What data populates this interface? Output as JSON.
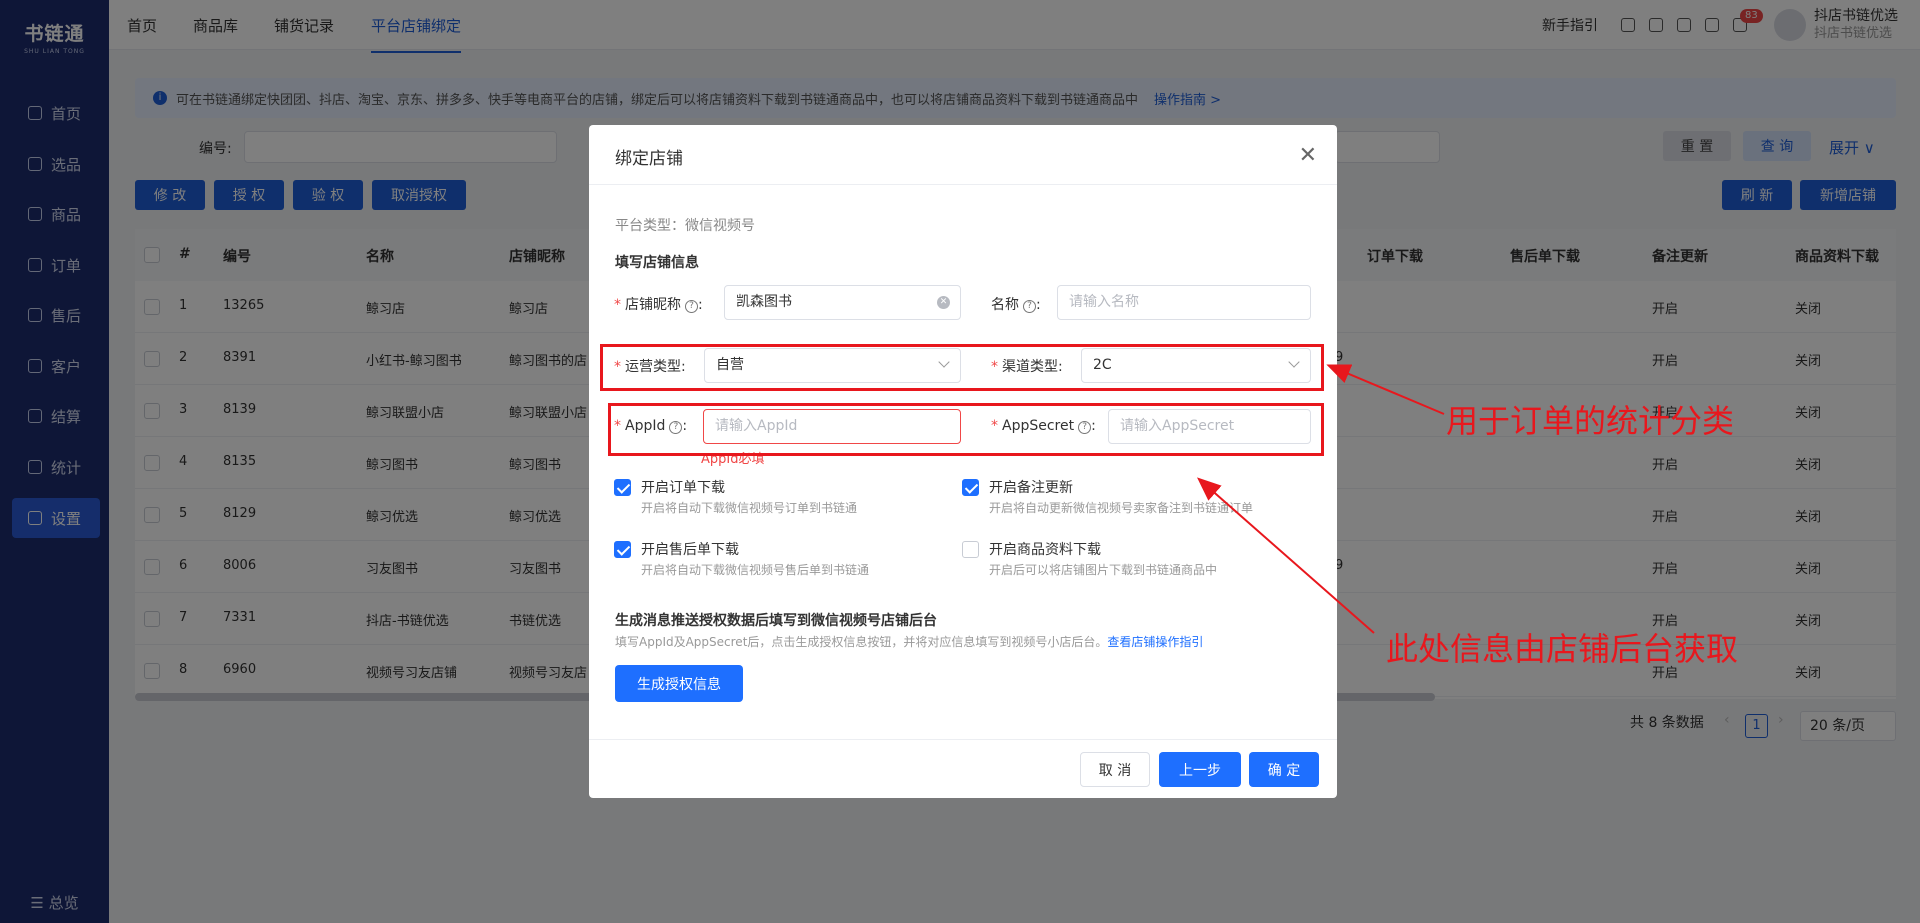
{
  "sidebar": {
    "logo_main": "书链通",
    "logo_sub": "SHU LIAN TONG",
    "items": [
      {
        "label": "首页",
        "icon": "monitor-icon"
      },
      {
        "label": "选品",
        "icon": "checklist-icon"
      },
      {
        "label": "商品",
        "icon": "box-icon"
      },
      {
        "label": "订单",
        "icon": "document-icon"
      },
      {
        "label": "售后",
        "icon": "refresh-icon"
      },
      {
        "label": "客户",
        "icon": "users-icon"
      },
      {
        "label": "结算",
        "icon": "settle-icon"
      },
      {
        "label": "统计",
        "icon": "clock-icon"
      },
      {
        "label": "设置",
        "icon": "sliders-icon"
      }
    ],
    "active_item": "设置",
    "bottom": "☰ 总览"
  },
  "topnav": {
    "tabs": [
      "首页",
      "商品库",
      "铺货记录",
      "平台店铺绑定"
    ],
    "active_tab": "平台店铺绑定",
    "guide": "新手指引",
    "notification_count": "83",
    "user_name": "抖店书链优选",
    "user_sub": "抖店书链优选"
  },
  "page": {
    "notice": "可在书链通绑定快团团、抖店、淘宝、京东、拼多多、快手等电商平台的店铺，绑定后可以将店铺资料下载到书链通商品中，也可以将店铺商品资料下载到书链通商品中",
    "notice_link": "操作指南 >",
    "filter_label": "编号:",
    "buttons": {
      "reset": "重 置",
      "query": "查 询",
      "expand": "展开 ∨",
      "edit": "修 改",
      "auth": "授 权",
      "verify": "验 权",
      "cancel_auth": "取消授权",
      "refresh": "刷 新",
      "add_store": "新增店铺"
    },
    "table": {
      "headers_left": [
        "#",
        "编号",
        "名称",
        "店铺昵称"
      ],
      "headers_right": [
        "订单下载",
        "售后单下载",
        "备注更新",
        "商品资料下载"
      ],
      "rows": [
        {
          "idx": "1",
          "id": "13265",
          "name": "鲸习店",
          "nick": "鲸习店",
          "right_mark": "",
          "remark": "开启",
          "goods": "关闭"
        },
        {
          "idx": "2",
          "id": "8391",
          "name": "小红书-鲸习图书",
          "nick": "鲸习图书的店",
          "right_mark": "9",
          "remark": "开启",
          "goods": "关闭"
        },
        {
          "idx": "3",
          "id": "8139",
          "name": "鲸习联盟小店",
          "nick": "鲸习联盟小店",
          "right_mark": "",
          "remark": "开启",
          "goods": "关闭"
        },
        {
          "idx": "4",
          "id": "8135",
          "name": "鲸习图书",
          "nick": "鲸习图书",
          "right_mark": "",
          "remark": "开启",
          "goods": "关闭"
        },
        {
          "idx": "5",
          "id": "8129",
          "name": "鲸习优选",
          "nick": "鲸习优选",
          "right_mark": "",
          "remark": "开启",
          "goods": "关闭"
        },
        {
          "idx": "6",
          "id": "8006",
          "name": "习友图书",
          "nick": "习友图书",
          "right_mark": "9",
          "remark": "开启",
          "goods": "关闭"
        },
        {
          "idx": "7",
          "id": "7331",
          "name": "抖店-书链优选",
          "nick": "书链优选",
          "right_mark": "",
          "remark": "开启",
          "goods": "关闭"
        },
        {
          "idx": "8",
          "id": "6960",
          "name": "视频号习友店铺",
          "nick": "视频号习友店",
          "right_mark": "",
          "remark": "开启",
          "goods": "关闭"
        }
      ]
    },
    "pager": {
      "total": "共 8 条数据",
      "current": "1",
      "page_size": "20 条/页"
    }
  },
  "modal": {
    "title": "绑定店铺",
    "platform": "平台类型：微信视频号",
    "section": "填写店铺信息",
    "store_nick_label": "店铺昵称",
    "store_nick_value": "凯森图书",
    "name_label": "名称",
    "name_placeholder": "请输入名称",
    "op_type_label": "运营类型:",
    "op_type_value": "自营",
    "channel_label": "渠道类型:",
    "channel_value": "2C",
    "appid_label": "AppId",
    "appid_placeholder": "请输入AppId",
    "appid_error": "AppId必填",
    "secret_label": "AppSecret",
    "secret_placeholder": "请输入AppSecret",
    "checks": [
      {
        "title": "开启订单下载",
        "desc": "开启将自动下载微信视频号订单到书链通",
        "checked": true
      },
      {
        "title": "开启备注更新",
        "desc": "开启将自动更新微信视频号卖家备注到书链通订单",
        "checked": true
      },
      {
        "title": "开启售后单下载",
        "desc": "开启将自动下载微信视频号售后单到书链通",
        "checked": true
      },
      {
        "title": "开启商品资料下载",
        "desc": "开启后可以将店铺图片下载到书链通商品中",
        "checked": false
      }
    ],
    "gen_title": "生成消息推送授权数据后填写到微信视频号店铺后台",
    "gen_desc": "填写AppId及AppSecret后，点击生成授权信息按钮，并将对应信息填写到视频号小店后台。",
    "gen_link": "查看店铺操作指引",
    "gen_button": "生成授权信息",
    "cancel": "取 消",
    "prev": "上一步",
    "ok": "确 定"
  },
  "annotations": {
    "text1": "用于订单的统计分类",
    "text2": "此处信息由店铺后台获取",
    "color": "#e8171d"
  }
}
